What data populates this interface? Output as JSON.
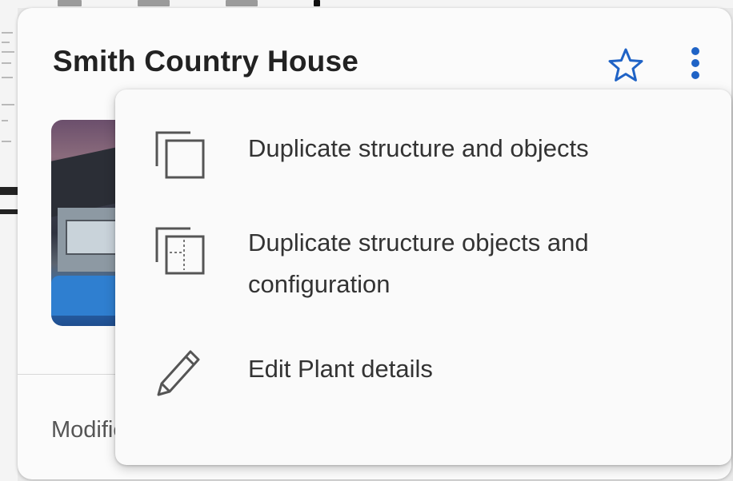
{
  "card": {
    "title": "Smith Country House",
    "modified_label": "Modified",
    "star_icon": "star-outline-icon",
    "more_icon": "more-vert-icon"
  },
  "menu": {
    "items": [
      {
        "icon": "duplicate-icon",
        "label": "Duplicate structure and objects"
      },
      {
        "icon": "duplicate-config-icon",
        "label_line1": "Duplicate structure objects and",
        "label_line2": "configuration"
      },
      {
        "icon": "pencil-icon",
        "label": "Edit Plant details"
      }
    ]
  },
  "colors": {
    "accent": "#1f63c6",
    "title": "#222222",
    "menu_text": "#333333",
    "icon_gray": "#555555"
  }
}
